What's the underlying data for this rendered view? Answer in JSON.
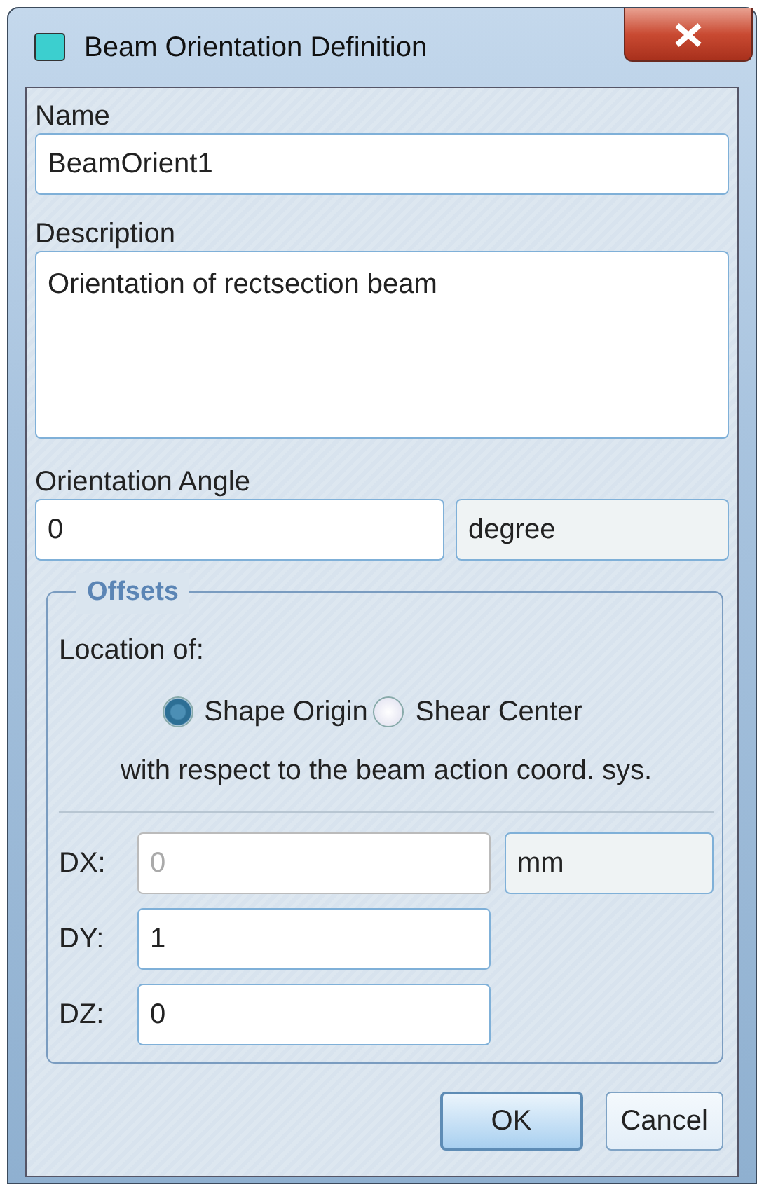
{
  "window": {
    "title": "Beam Orientation Definition"
  },
  "name": {
    "label": "Name",
    "value": "BeamOrient1"
  },
  "description": {
    "label": "Description",
    "value": "Orientation of rectsection beam"
  },
  "orientation_angle": {
    "label": "Orientation Angle",
    "value": "0",
    "unit": "degree"
  },
  "offsets": {
    "legend": "Offsets",
    "location_label": "Location of:",
    "options": [
      {
        "label": "Shape Origin",
        "selected": true
      },
      {
        "label": "Shear Center",
        "selected": false
      }
    ],
    "note": "with respect to the beam action coord. sys.",
    "rows": [
      {
        "label": "DX:",
        "value": "0",
        "disabled": true,
        "unit": "mm"
      },
      {
        "label": "DY:",
        "value": "1",
        "disabled": false
      },
      {
        "label": "DZ:",
        "value": "0",
        "disabled": false
      }
    ]
  },
  "buttons": [
    {
      "label": "OK",
      "default": true
    },
    {
      "label": "Cancel",
      "default": false
    }
  ]
}
